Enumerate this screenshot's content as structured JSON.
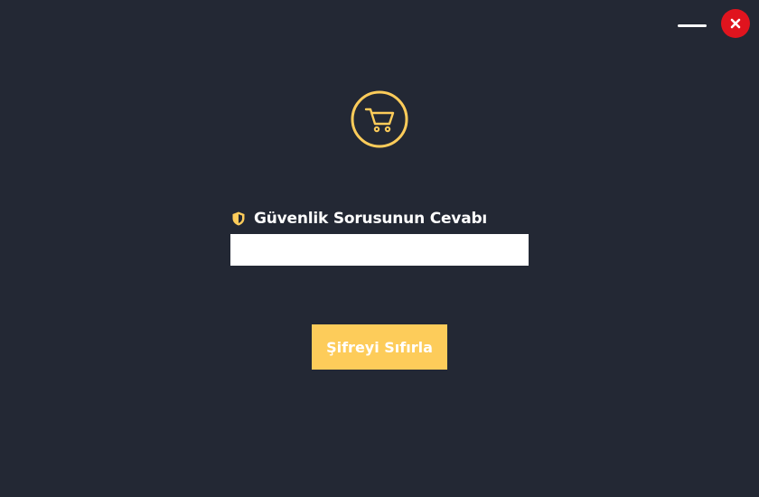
{
  "window": {
    "minimize_icon": "minimize-icon",
    "close_icon": "close-icon",
    "close_color": "#e0141e"
  },
  "logo": {
    "icon": "shopping-cart-icon",
    "color": "#fdcc5a"
  },
  "form": {
    "label_icon": "shield-icon",
    "answer_label": "Güvenlik Sorusunun Cevabı",
    "answer_value": "",
    "submit_label": "Şifreyi Sıfırla"
  },
  "colors": {
    "background": "#232834",
    "accent": "#fdcc5a",
    "text": "#ffffff"
  }
}
